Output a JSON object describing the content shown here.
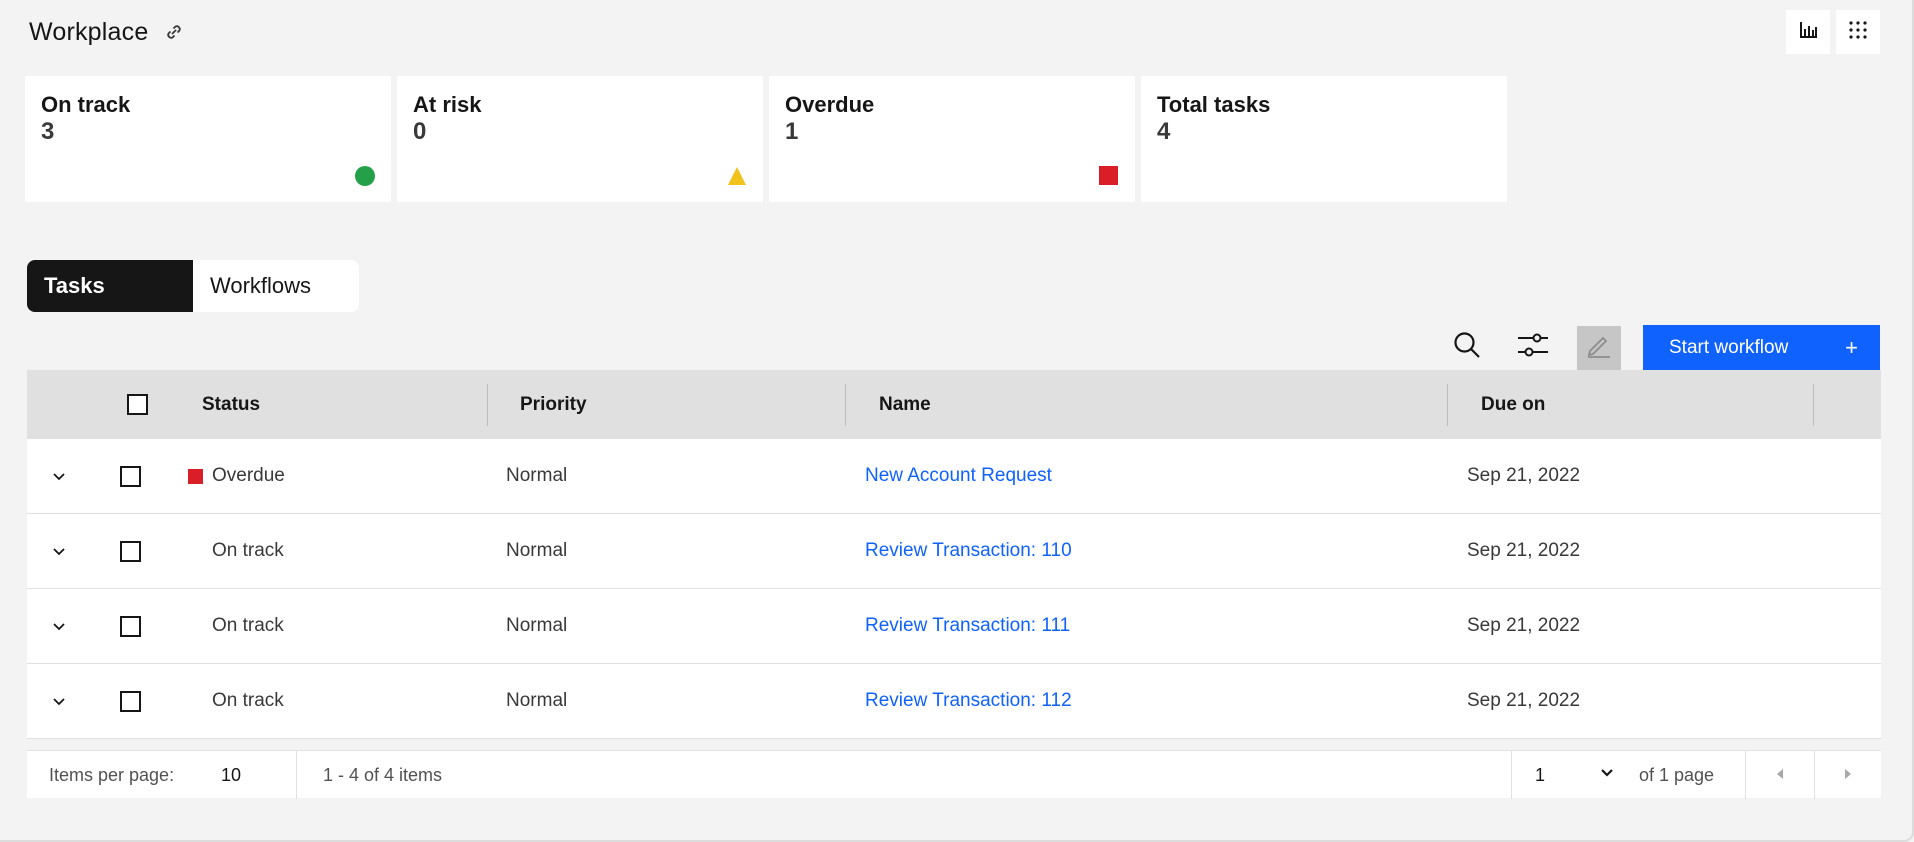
{
  "header": {
    "title": "Workplace",
    "link_icon": "link-icon",
    "actions": [
      "chart-icon",
      "grid-menu-icon"
    ]
  },
  "summary": [
    {
      "label": "On track",
      "value": "3",
      "indicator": "green-circle",
      "color": "#24a148"
    },
    {
      "label": "At risk",
      "value": "0",
      "indicator": "yellow-triangle",
      "color": "#f1c21b"
    },
    {
      "label": "Overdue",
      "value": "1",
      "indicator": "red-square",
      "color": "#da1e28"
    },
    {
      "label": "Total tasks",
      "value": "4",
      "indicator": "",
      "color": ""
    }
  ],
  "tabs": [
    {
      "label": "Tasks",
      "active": true
    },
    {
      "label": "Workflows",
      "active": false
    }
  ],
  "toolbar": {
    "icons": [
      "search-icon",
      "filter-icon",
      "edit-icon"
    ],
    "primary_label": "Start workflow",
    "primary_icon": "+"
  },
  "table": {
    "columns": [
      "Status",
      "Priority",
      "Name",
      "Due on"
    ],
    "rows": [
      {
        "status": "Overdue",
        "priority": "Normal",
        "name": "New Account Request",
        "due": "Sep 21, 2022"
      },
      {
        "status": "On track",
        "priority": "Normal",
        "name": "Review Transaction: 110",
        "due": "Sep 21, 2022"
      },
      {
        "status": "On track",
        "priority": "Normal",
        "name": "Review Transaction: 111",
        "due": "Sep 21, 2022"
      },
      {
        "status": "On track",
        "priority": "Normal",
        "name": "Review Transaction: 112",
        "due": "Sep 21, 2022"
      }
    ]
  },
  "pagination": {
    "items_per_page_label": "Items per page:",
    "items_per_page": "10",
    "range": "1 - 4 of 4 items",
    "page": "1",
    "of_pages": "of 1 page"
  },
  "colors": {
    "primary": "#0f62fe",
    "on_track": "#24a148",
    "at_risk": "#f1c21b",
    "overdue": "#da1e28"
  }
}
